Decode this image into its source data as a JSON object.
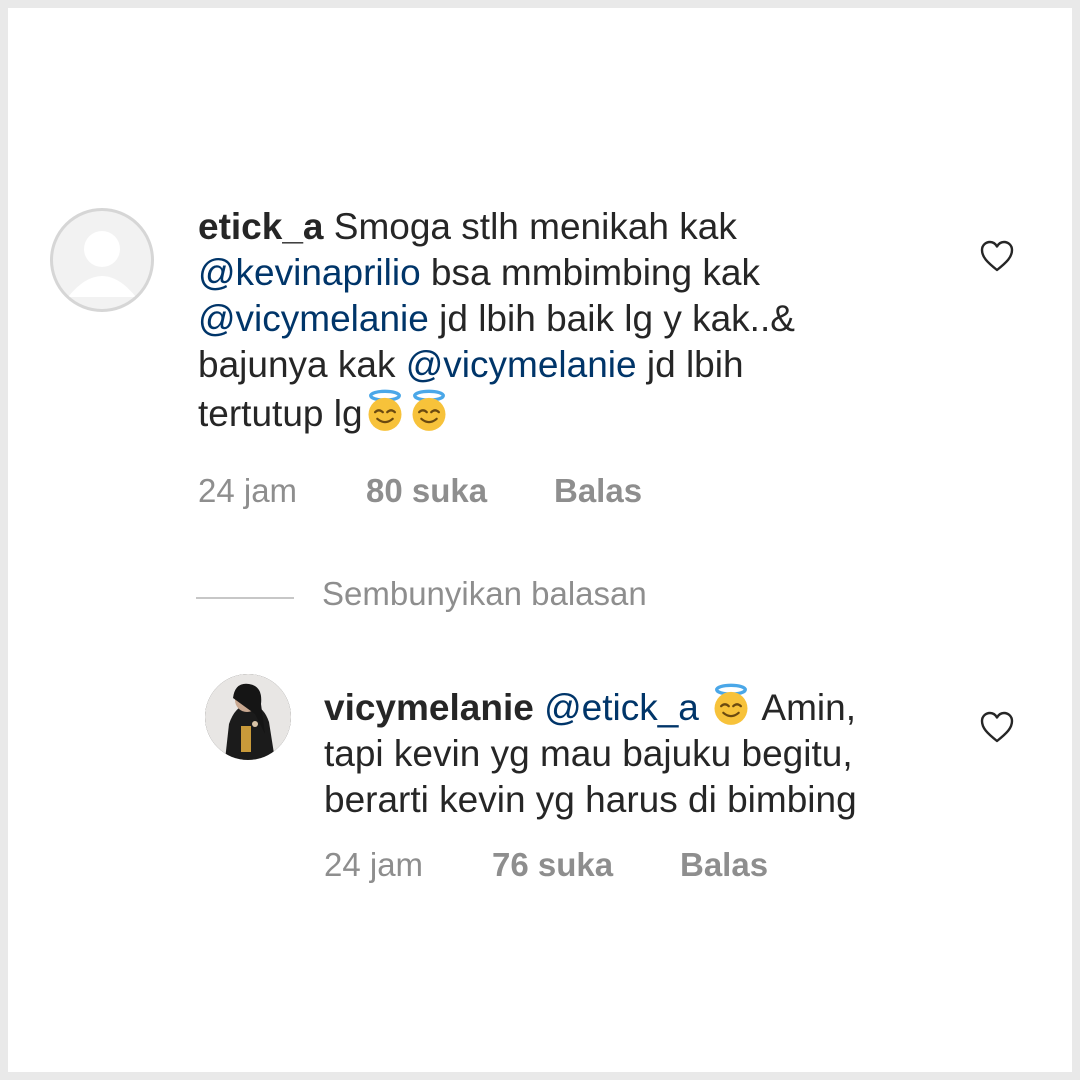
{
  "comments": [
    {
      "username": "etick_a",
      "text_parts": {
        "p1": "Smoga stlh menikah kak",
        "m1": "@kevinaprilio",
        "p2": " bsa mmbimbing kak",
        "m2": "@vicymelanie",
        "p3": " jd lbih baik lg y kak..&",
        "p4": "bajunya kak ",
        "m3": "@vicymelanie",
        "p5": " jd lbih",
        "p6": "tertutup lg"
      },
      "emoji": [
        "smiling-face-with-halo",
        "smiling-face-with-halo"
      ],
      "time": "24 jam",
      "likes": "80 suka",
      "reply_label": "Balas"
    },
    {
      "username": "vicymelanie",
      "text_parts": {
        "m1": "@etick_a",
        "p1": " Amin,",
        "p2": "tapi kevin yg mau bajuku begitu,",
        "p3": "berarti kevin yg harus di bimbing"
      },
      "emoji": [
        "smiling-face-with-halo"
      ],
      "time": "24 jam",
      "likes": "76 suka",
      "reply_label": "Balas"
    }
  ],
  "replies_toggle": {
    "label": "Sembunyikan balasan"
  },
  "colors": {
    "text": "#262626",
    "mention": "#003569",
    "muted": "#8e8e8e",
    "emoji_face": "#f7c23a",
    "halo": "#4aa7e8"
  }
}
